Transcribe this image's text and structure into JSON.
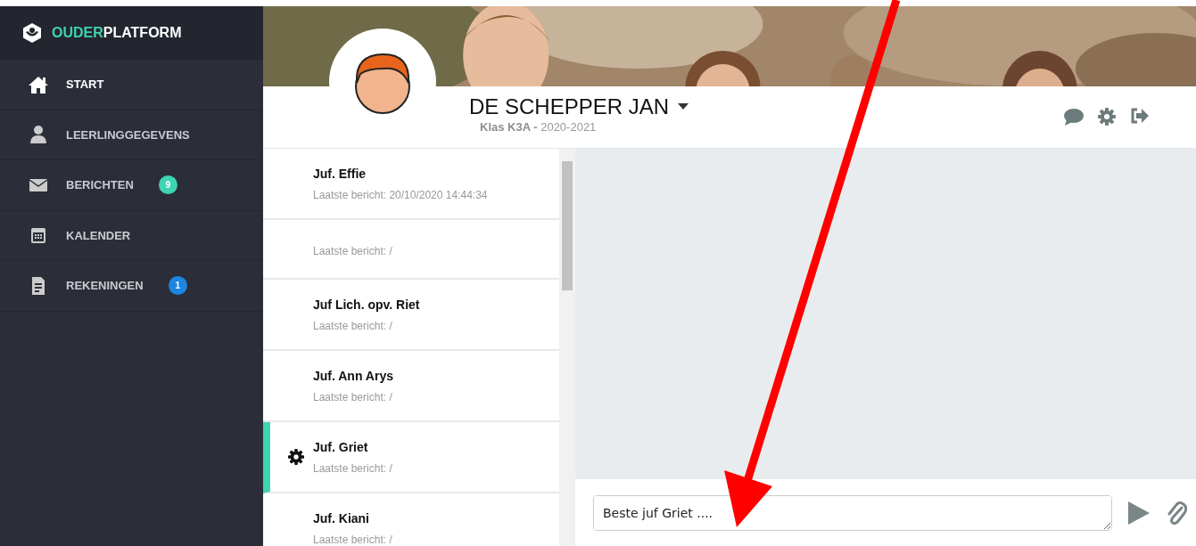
{
  "brand": {
    "highlight": "OUDER",
    "rest": "PLATFORM"
  },
  "sidebar": {
    "items": [
      {
        "label": "START",
        "selected": true
      },
      {
        "label": "LEERLINGGEGEVENS",
        "selected": false
      },
      {
        "label": "BERICHTEN",
        "selected": false,
        "badge": "9",
        "color": "#3fd3b1"
      },
      {
        "label": "KALENDER",
        "selected": false
      },
      {
        "label": "REKENINGEN",
        "selected": false,
        "badge": "1",
        "color": "#1c86e0"
      }
    ]
  },
  "profile": {
    "name": "DE SCHEPPER JAN",
    "class_label": "Klas K3A -",
    "year": "2020-2021"
  },
  "contacts": [
    {
      "name": "Juf. Effie",
      "last_message": "Laatste bericht: 20/10/2020 14:44:34",
      "selected": false
    },
    {
      "last_message": "Laatste bericht: /",
      "selected": false
    },
    {
      "name": "Juf Lich. opv. Riet",
      "last_message": "Laatste bericht: /",
      "selected": false
    },
    {
      "name": "Juf. Ann Arys",
      "last_message": "Laatste bericht: /",
      "selected": false
    },
    {
      "name": "Juf. Griet",
      "last_message": "Laatste bericht: /",
      "selected": true
    },
    {
      "name": "Juf. Kiani",
      "last_message": "Laatste bericht: /",
      "selected": false
    }
  ],
  "composer": {
    "value": "Beste juf Griet ...."
  }
}
